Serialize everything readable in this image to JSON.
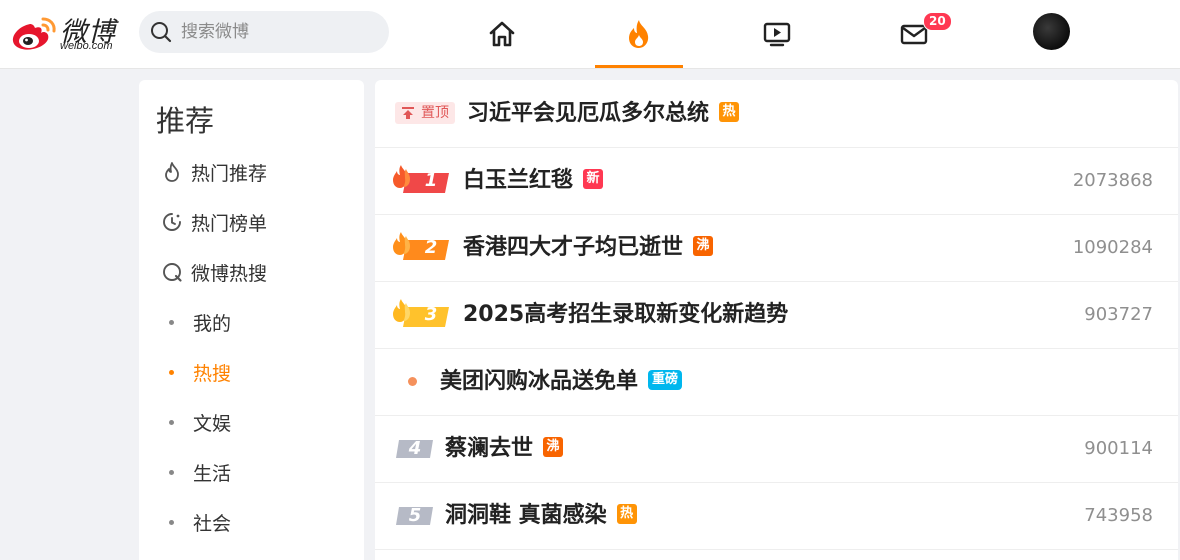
{
  "header": {
    "logo_name": "微博",
    "logo_domain": "weibo.com",
    "search_placeholder": "搜索微博",
    "nav": [
      {
        "key": "home",
        "icon": "home-icon"
      },
      {
        "key": "hot",
        "icon": "fire-icon",
        "active": true
      },
      {
        "key": "video",
        "icon": "video-icon"
      },
      {
        "key": "messages",
        "icon": "mail-icon",
        "badge": "20"
      }
    ],
    "accent_color": "#ff8200"
  },
  "sidebar": {
    "title": "推荐",
    "items": [
      {
        "label": "热门推荐",
        "icon": "fire-outline-icon"
      },
      {
        "label": "热门榜单",
        "icon": "clock-rank-icon"
      },
      {
        "label": "微博热搜",
        "icon": "search-ring-icon"
      },
      {
        "label": "我的",
        "icon": "dot"
      },
      {
        "label": "热搜",
        "icon": "dot",
        "active": true
      },
      {
        "label": "文娱",
        "icon": "dot"
      },
      {
        "label": "生活",
        "icon": "dot"
      },
      {
        "label": "社会",
        "icon": "dot"
      }
    ]
  },
  "hotlist": {
    "pinned": {
      "pin_label": "置顶",
      "title": "习近平会见厄瓜多尔总统",
      "tag": "热",
      "tag_color": "#ff9406"
    },
    "items": [
      {
        "rank": "1",
        "title": "白玉兰红毯",
        "tag": "新",
        "tag_color": "#ff3852",
        "count": "2073868"
      },
      {
        "rank": "2",
        "title": "香港四大才子均已逝世",
        "tag": "沸",
        "tag_color": "#f86400",
        "count": "1090284"
      },
      {
        "rank": "3",
        "title": "2025高考招生录取新变化新趋势",
        "tag": "",
        "tag_color": "",
        "count": "903727"
      },
      {
        "rank": "",
        "title": "美团闪购冰品送免单",
        "tag": "重磅",
        "tag_color": "#00b7ee",
        "count": ""
      },
      {
        "rank": "4",
        "title": "蔡澜去世",
        "tag": "沸",
        "tag_color": "#f86400",
        "count": "900114"
      },
      {
        "rank": "5",
        "title": "洞洞鞋 真菌感染",
        "tag": "热",
        "tag_color": "#ff9406",
        "count": "743958"
      }
    ]
  }
}
